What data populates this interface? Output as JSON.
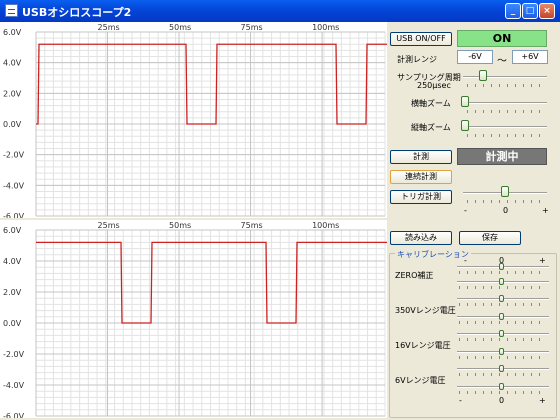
{
  "window": {
    "title": "USBオシロスコープ2",
    "min_label": "_",
    "max_label": "□",
    "close_label": "×"
  },
  "scope_top": {
    "y_labels": [
      "6.0V",
      "4.0V",
      "2.0V",
      "0.0V",
      "-2.0V",
      "-4.0V",
      "-6.0V"
    ],
    "x_labels": [
      "25ms",
      "50ms",
      "75ms",
      "100ms"
    ],
    "trace_color": "#cc2222",
    "transitions": [
      [
        0,
        0
      ],
      [
        2,
        0
      ],
      [
        3,
        5.2
      ],
      [
        150,
        5.2
      ],
      [
        151,
        0
      ],
      [
        180,
        0
      ],
      [
        181,
        5.2
      ],
      [
        300,
        5.2
      ],
      [
        301,
        0
      ],
      [
        330,
        0
      ],
      [
        331,
        5.2
      ],
      [
        372,
        5.2
      ]
    ]
  },
  "scope_bottom": {
    "y_labels": [
      "6.0V",
      "4.0V",
      "2.0V",
      "0.0V",
      "-2.0V",
      "-4.0V",
      "-6.0V"
    ],
    "x_labels": [
      "25ms",
      "50ms",
      "75ms",
      "100ms"
    ],
    "trace_color": "#cc2222",
    "transitions": [
      [
        0,
        5.2
      ],
      [
        85,
        5.2
      ],
      [
        86,
        0
      ],
      [
        115,
        0
      ],
      [
        116,
        5.2
      ],
      [
        230,
        5.2
      ],
      [
        231,
        0
      ],
      [
        260,
        0
      ],
      [
        261,
        5.2
      ],
      [
        372,
        5.2
      ],
      [
        373,
        0
      ]
    ]
  },
  "controls": {
    "usb_button": "USB ON/OFF",
    "usb_status": "ON",
    "range_label": "計測レンジ",
    "range_min": "-6V",
    "range_sep": "〜",
    "range_max": "+6V",
    "sampling_label": "サンプリング周期",
    "sampling_value": "250µsec",
    "hzoom_label": "横軸ズーム",
    "vzoom_label": "縦軸ズーム",
    "measure_button": "計測",
    "measure_status": "計測中",
    "continuous_button": "連続計測",
    "trigger_button": "トリガ計測",
    "trigger_minus": "-",
    "trigger_value": "0",
    "trigger_plus": "+",
    "load_button": "読み込み",
    "save_button": "保存",
    "calibration_title": "キャリブレーション",
    "cal_top_minus": "-",
    "cal_top_value": "0",
    "cal_top_plus": "+",
    "zero_label": "ZERO補正",
    "r350_label": "350Vレンジ電圧",
    "r16_label": "16Vレンジ電圧",
    "r6_label": "6Vレンジ電圧",
    "cal_bottom_minus": "-",
    "cal_bottom_value": "0",
    "cal_bottom_plus": "+"
  },
  "colors": {
    "status_on": "#88e388",
    "status_measuring": "#777777",
    "trace": "#cc2222"
  }
}
